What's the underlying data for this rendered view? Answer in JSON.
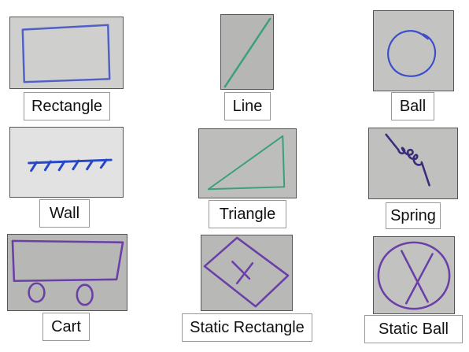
{
  "colors": {
    "ink_blue": "#3b4ec8",
    "ink_teal": "#3aa07a",
    "ink_purple": "#6a3fa8",
    "board_gray": "#b9b9b7",
    "board_light": "#dcdcdc"
  },
  "items": [
    {
      "label": "Rectangle",
      "icon": "rectangle-sketch-icon"
    },
    {
      "label": "Line",
      "icon": "line-sketch-icon"
    },
    {
      "label": "Ball",
      "icon": "ball-sketch-icon"
    },
    {
      "label": "Wall",
      "icon": "wall-sketch-icon"
    },
    {
      "label": "Triangle",
      "icon": "triangle-sketch-icon"
    },
    {
      "label": "Spring",
      "icon": "spring-sketch-icon"
    },
    {
      "label": "Cart",
      "icon": "cart-sketch-icon"
    },
    {
      "label": "Static Rectangle",
      "icon": "static-rectangle-sketch-icon"
    },
    {
      "label": "Static Ball",
      "icon": "static-ball-sketch-icon"
    }
  ]
}
